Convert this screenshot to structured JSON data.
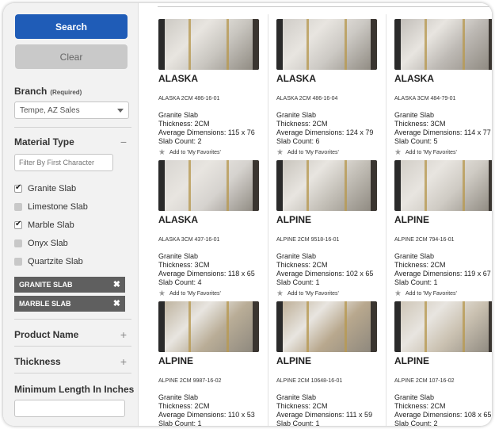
{
  "sidebar": {
    "search_label": "Search",
    "clear_label": "Clear",
    "branch": {
      "label": "Branch",
      "required": "(Required)",
      "selected": "Tempe, AZ Sales"
    },
    "material_type": {
      "label": "Material Type",
      "collapse": "−",
      "filter_placeholder": "Filter By First Character",
      "options": [
        {
          "label": "Granite Slab",
          "checked": true
        },
        {
          "label": "Limestone Slab",
          "checked": false
        },
        {
          "label": "Marble Slab",
          "checked": true
        },
        {
          "label": "Onyx Slab",
          "checked": false
        },
        {
          "label": "Quartzite Slab",
          "checked": false
        }
      ],
      "chips": [
        "GRANITE SLAB",
        "MARBLE SLAB"
      ]
    },
    "product_name": {
      "label": "Product Name",
      "expand": "+"
    },
    "thickness": {
      "label": "Thickness",
      "expand": "+"
    },
    "min_length": {
      "label": "Minimum Length In Inches"
    }
  },
  "products": [
    {
      "title": "ALASKA",
      "sku": "ALASKA 2CM 486-16-01",
      "type": "Granite Slab",
      "thickness": "Thickness: 2CM",
      "dims": "Average Dimensions: 115 x 76",
      "count": "Slab Count: 2",
      "fav": "Add to 'My Favorites'",
      "tone": "#c9c6c0"
    },
    {
      "title": "ALASKA",
      "sku": "ALASKA 2CM 486-16-04",
      "type": "Granite Slab",
      "thickness": "Thickness: 2CM",
      "dims": "Average Dimensions: 124 x 79",
      "count": "Slab Count: 6",
      "fav": "Add to 'My Favorites'",
      "tone": "#ccc9c4"
    },
    {
      "title": "ALASKA",
      "sku": "ALASKA 3CM 484-79-01",
      "type": "Granite Slab",
      "thickness": "Thickness: 3CM",
      "dims": "Average Dimensions: 114 x 77",
      "count": "Slab Count: 5",
      "fav": "Add to 'My Favorites'",
      "tone": "#bdb9b4"
    },
    {
      "title": "ALASKA",
      "sku": "ALASKA 3CM 437-16-01",
      "type": "Granite Slab",
      "thickness": "Thickness: 3CM",
      "dims": "Average Dimensions: 118 x 65",
      "count": "Slab Count: 4",
      "fav": "Add to 'My Favorites'",
      "tone": "#d6d3cf"
    },
    {
      "title": "ALPINE",
      "sku": "ALPINE 2CM 9518-16-01",
      "type": "Granite Slab",
      "thickness": "Thickness: 2CM",
      "dims": "Average Dimensions: 102 x 65",
      "count": "Slab Count: 1",
      "fav": "Add to 'My Favorites'",
      "tone": "#c4c0b8"
    },
    {
      "title": "ALPINE",
      "sku": "ALPINE 2CM 794-16-01",
      "type": "Granite Slab",
      "thickness": "Thickness: 2CM",
      "dims": "Average Dimensions: 119 x 67",
      "count": "Slab Count: 1",
      "fav": "Add to 'My Favorites'",
      "tone": "#cfcbc4"
    },
    {
      "title": "ALPINE",
      "sku": "ALPINE 2CM 9987-16-02",
      "type": "Granite Slab",
      "thickness": "Thickness: 2CM",
      "dims": "Average Dimensions: 110 x 53",
      "count": "Slab Count: 1",
      "fav": "",
      "tone": "#b9ad97"
    },
    {
      "title": "ALPINE",
      "sku": "ALPINE 2CM 10648-16-01",
      "type": "Granite Slab",
      "thickness": "Thickness: 2CM",
      "dims": "Average Dimensions: 111 x 59",
      "count": "Slab Count: 1",
      "fav": "",
      "tone": "#b8a88e"
    },
    {
      "title": "ALPINE",
      "sku": "ALPINE 2CM 107-16-02",
      "type": "Granite Slab",
      "thickness": "Thickness: 2CM",
      "dims": "Average Dimensions: 108 x 65",
      "count": "Slab Count: 2",
      "fav": "",
      "tone": "#cbc2b2"
    }
  ]
}
